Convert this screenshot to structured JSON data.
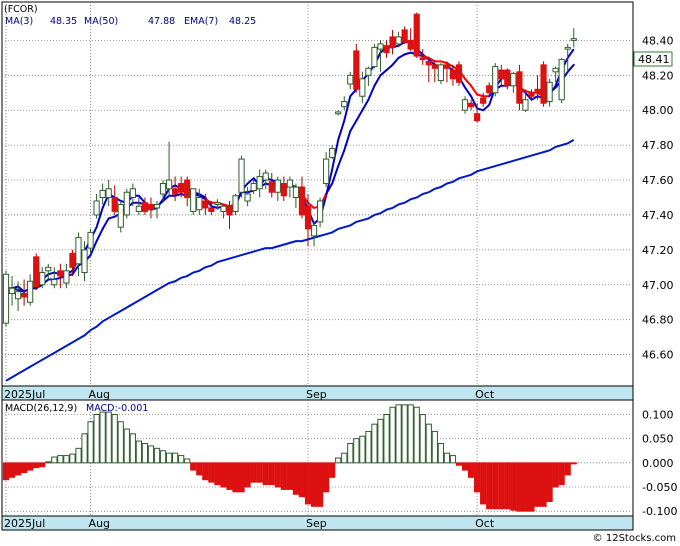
{
  "legend": {
    "ticker": "(FCOR)",
    "ma3": "MA(3)",
    "ma3_val": "48.35",
    "ma50": "MA(50)",
    "ma50_val": "47.88",
    "ema7": "EMA(7)",
    "ema7_val": "48.25"
  },
  "macd_legend": {
    "label": "MACD(26,12,9)",
    "value": "MACD:-0.001"
  },
  "last_price_label": "48.41",
  "watermark": "© 12Stocks.com",
  "colors": {
    "up": "#2e7d32",
    "down": "#dd1111",
    "ma_short": "#0000cc",
    "ma50": "#0018cc",
    "ema": "#ff0000",
    "axis_band": "#bfe6f0",
    "macd_up": "#2e7d32",
    "macd_down": "#dd1111"
  },
  "chart_data": [
    {
      "type": "candlestick",
      "title": "(FCOR)",
      "ylim": [
        46.42,
        48.62
      ],
      "y_ticks": [
        "46.60",
        "46.80",
        "47.00",
        "47.20",
        "47.40",
        "47.60",
        "47.80",
        "48.00",
        "48.20",
        "48.40"
      ],
      "x_ticks": [
        {
          "label": "2025Jul",
          "index": 0
        },
        {
          "label": "Aug",
          "index": 14
        },
        {
          "label": "Sep",
          "index": 50
        },
        {
          "label": "Oct",
          "index": 78
        }
      ],
      "candles": [
        [
          46.78,
          47.08,
          46.76,
          47.06
        ],
        [
          46.95,
          47.05,
          46.88,
          46.98
        ],
        [
          46.92,
          47.02,
          46.85,
          46.96
        ],
        [
          46.95,
          47.03,
          46.88,
          46.93
        ],
        [
          46.9,
          47.06,
          46.88,
          47.02
        ],
        [
          47.16,
          47.18,
          46.97,
          46.99
        ],
        [
          47.0,
          47.1,
          46.98,
          47.07
        ],
        [
          47.08,
          47.12,
          47.03,
          47.1
        ],
        [
          47.0,
          47.1,
          46.98,
          47.03
        ],
        [
          47.08,
          47.12,
          46.98,
          47.05
        ],
        [
          47.01,
          47.12,
          46.98,
          47.08
        ],
        [
          47.18,
          47.2,
          47.05,
          47.1
        ],
        [
          47.12,
          47.3,
          47.05,
          47.27
        ],
        [
          47.07,
          47.25,
          47.02,
          47.2
        ],
        [
          47.21,
          47.32,
          47.18,
          47.3
        ],
        [
          47.4,
          47.52,
          47.38,
          47.48
        ],
        [
          47.5,
          47.58,
          47.46,
          47.54
        ],
        [
          47.5,
          47.6,
          47.45,
          47.55
        ],
        [
          47.5,
          47.57,
          47.4,
          47.42
        ],
        [
          47.33,
          47.48,
          47.3,
          47.46
        ],
        [
          47.4,
          47.55,
          47.38,
          47.53
        ],
        [
          47.5,
          47.58,
          47.45,
          47.55
        ],
        [
          47.42,
          47.5,
          47.4,
          47.45
        ],
        [
          47.47,
          47.5,
          47.4,
          47.42
        ],
        [
          47.46,
          47.5,
          47.38,
          47.43
        ],
        [
          47.44,
          47.48,
          47.38,
          47.46
        ],
        [
          47.52,
          47.6,
          47.48,
          47.58
        ],
        [
          47.55,
          47.82,
          47.5,
          47.6
        ],
        [
          47.55,
          47.62,
          47.48,
          47.52
        ],
        [
          47.58,
          47.62,
          47.5,
          47.53
        ],
        [
          47.6,
          47.62,
          47.45,
          47.5
        ],
        [
          47.42,
          47.55,
          47.4,
          47.55
        ],
        [
          47.43,
          47.55,
          47.4,
          47.5
        ],
        [
          47.48,
          47.52,
          47.4,
          47.44
        ],
        [
          47.44,
          47.48,
          47.4,
          47.42
        ],
        [
          47.46,
          47.49,
          47.43,
          47.47
        ],
        [
          47.42,
          47.46,
          47.38,
          47.45
        ],
        [
          47.45,
          47.48,
          47.32,
          47.4
        ],
        [
          47.42,
          47.52,
          47.4,
          47.51
        ],
        [
          47.53,
          47.74,
          47.5,
          47.72
        ],
        [
          47.48,
          47.56,
          47.45,
          47.52
        ],
        [
          47.54,
          47.6,
          47.52,
          47.58
        ],
        [
          47.55,
          47.66,
          47.5,
          47.62
        ],
        [
          47.6,
          47.66,
          47.55,
          47.64
        ],
        [
          47.59,
          47.64,
          47.5,
          47.53
        ],
        [
          47.53,
          47.62,
          47.48,
          47.6
        ],
        [
          47.58,
          47.62,
          47.48,
          47.51
        ],
        [
          47.56,
          47.62,
          47.5,
          47.6
        ],
        [
          47.5,
          47.58,
          47.44,
          47.56
        ],
        [
          47.56,
          47.62,
          47.38,
          47.4
        ],
        [
          47.45,
          47.52,
          47.22,
          47.32
        ],
        [
          47.28,
          47.36,
          47.22,
          47.34
        ],
        [
          47.36,
          47.5,
          47.33,
          47.48
        ],
        [
          47.58,
          47.76,
          47.56,
          47.72
        ],
        [
          47.73,
          47.8,
          47.72,
          47.78
        ],
        [
          47.98,
          48.0,
          47.97,
          47.99
        ],
        [
          48.02,
          48.08,
          48.0,
          48.05
        ],
        [
          48.15,
          48.22,
          48.12,
          48.2
        ],
        [
          48.34,
          48.38,
          48.1,
          48.12
        ],
        [
          48.08,
          48.22,
          48.04,
          48.18
        ],
        [
          48.2,
          48.25,
          48.14,
          48.24
        ],
        [
          48.25,
          48.38,
          48.24,
          48.36
        ],
        [
          48.35,
          48.4,
          48.22,
          48.38
        ],
        [
          48.37,
          48.4,
          48.3,
          48.33
        ],
        [
          48.42,
          48.46,
          48.32,
          48.36
        ],
        [
          48.38,
          48.45,
          48.36,
          48.42
        ],
        [
          48.46,
          48.48,
          48.38,
          48.39
        ],
        [
          48.4,
          48.47,
          48.34,
          48.35
        ],
        [
          48.55,
          48.56,
          48.3,
          48.31
        ],
        [
          48.3,
          48.35,
          48.26,
          48.29
        ],
        [
          48.28,
          48.28,
          48.16,
          48.26
        ],
        [
          48.26,
          48.28,
          48.16,
          48.24
        ],
        [
          48.17,
          48.27,
          48.15,
          48.26
        ],
        [
          48.26,
          48.28,
          48.16,
          48.24
        ],
        [
          48.23,
          48.26,
          48.14,
          48.18
        ],
        [
          48.26,
          48.28,
          48.14,
          48.16
        ],
        [
          48.0,
          48.08,
          47.98,
          48.06
        ],
        [
          48.04,
          48.06,
          48.0,
          48.02
        ],
        [
          47.98,
          48.04,
          47.93,
          47.94
        ],
        [
          48.07,
          48.1,
          48.02,
          48.04
        ],
        [
          48.14,
          48.16,
          48.08,
          48.1
        ],
        [
          48.1,
          48.27,
          48.08,
          48.25
        ],
        [
          48.23,
          48.26,
          48.14,
          48.18
        ],
        [
          48.23,
          48.24,
          48.12,
          48.14
        ],
        [
          48.14,
          48.22,
          48.1,
          48.21
        ],
        [
          48.22,
          48.26,
          48.0,
          48.04
        ],
        [
          48.0,
          48.12,
          47.99,
          48.06
        ],
        [
          48.1,
          48.12,
          48.06,
          48.08
        ],
        [
          48.12,
          48.2,
          48.06,
          48.1
        ],
        [
          48.26,
          48.28,
          48.02,
          48.04
        ],
        [
          48.05,
          48.18,
          48.02,
          48.16
        ],
        [
          48.22,
          48.25,
          48.16,
          48.24
        ],
        [
          48.06,
          48.3,
          48.04,
          48.29
        ],
        [
          48.35,
          48.38,
          48.22,
          48.36
        ],
        [
          48.4,
          48.47,
          48.36,
          48.41
        ]
      ],
      "ma3": [
        46.95,
        46.98,
        46.99,
        46.96,
        46.98,
        46.98,
        47.03,
        47.06,
        47.07,
        47.06,
        47.06,
        47.08,
        47.15,
        47.19,
        47.26,
        47.33,
        47.44,
        47.52,
        47.5,
        47.48,
        47.47,
        47.51,
        47.51,
        47.47,
        47.43,
        47.44,
        47.49,
        47.55,
        47.57,
        47.55,
        47.52,
        47.53,
        47.52,
        47.5,
        47.45,
        47.44,
        47.45,
        47.44,
        47.45,
        47.54,
        47.58,
        47.61,
        47.57,
        47.61,
        47.6,
        47.59,
        47.55,
        47.57,
        47.56,
        47.52,
        47.43,
        47.35,
        47.38,
        47.51,
        47.66,
        47.83,
        47.94,
        48.08,
        48.12,
        48.17,
        48.21,
        48.26,
        48.33,
        48.36,
        48.36,
        48.37,
        48.39,
        48.39,
        48.35,
        48.32,
        48.29,
        48.26,
        48.25,
        48.25,
        48.23,
        48.19,
        48.13,
        48.08,
        48.01,
        48.0,
        48.03,
        48.13,
        48.18,
        48.19,
        48.18,
        48.13,
        48.1,
        48.06,
        48.08,
        48.07,
        48.09,
        48.14,
        48.23,
        48.3,
        48.35
      ],
      "ema7": [
        46.98,
        46.98,
        46.97,
        46.96,
        46.98,
        46.98,
        47.0,
        47.03,
        47.03,
        47.04,
        47.05,
        47.06,
        47.11,
        47.13,
        47.17,
        47.25,
        47.32,
        47.38,
        47.39,
        47.41,
        47.44,
        47.47,
        47.47,
        47.46,
        47.45,
        47.45,
        47.48,
        47.51,
        47.51,
        47.52,
        47.51,
        47.52,
        47.51,
        47.49,
        47.47,
        47.47,
        47.46,
        47.45,
        47.46,
        47.53,
        47.53,
        47.54,
        47.56,
        47.58,
        47.57,
        47.58,
        47.56,
        47.57,
        47.56,
        47.52,
        47.47,
        47.44,
        47.45,
        47.52,
        47.58,
        47.68,
        47.77,
        47.88,
        47.94,
        48.0,
        48.06,
        48.14,
        48.2,
        48.23,
        48.26,
        48.3,
        48.32,
        48.33,
        48.32,
        48.31,
        48.3,
        48.28,
        48.28,
        48.27,
        48.25,
        48.23,
        48.18,
        48.14,
        48.09,
        48.08,
        48.08,
        48.12,
        48.14,
        48.14,
        48.16,
        48.13,
        48.11,
        48.1,
        48.1,
        48.08,
        48.1,
        48.13,
        48.17,
        48.22,
        48.26
      ],
      "ma50": [
        46.45,
        46.47,
        46.49,
        46.51,
        46.53,
        46.55,
        46.57,
        46.59,
        46.61,
        46.63,
        46.65,
        46.67,
        46.69,
        46.71,
        46.74,
        46.76,
        46.79,
        46.81,
        46.83,
        46.85,
        46.87,
        46.89,
        46.91,
        46.93,
        46.95,
        46.97,
        46.99,
        47.01,
        47.02,
        47.04,
        47.05,
        47.07,
        47.08,
        47.1,
        47.11,
        47.13,
        47.14,
        47.15,
        47.16,
        47.17,
        47.18,
        47.19,
        47.2,
        47.21,
        47.21,
        47.22,
        47.23,
        47.24,
        47.25,
        47.25,
        47.26,
        47.27,
        47.28,
        47.29,
        47.3,
        47.32,
        47.33,
        47.34,
        47.36,
        47.37,
        47.38,
        47.4,
        47.41,
        47.43,
        47.44,
        47.46,
        47.47,
        47.49,
        47.5,
        47.52,
        47.53,
        47.55,
        47.56,
        47.58,
        47.59,
        47.61,
        47.62,
        47.63,
        47.65,
        47.66,
        47.67,
        47.68,
        47.69,
        47.7,
        47.71,
        47.72,
        47.73,
        47.74,
        47.75,
        47.76,
        47.77,
        47.79,
        47.8,
        47.81,
        47.83
      ]
    },
    {
      "type": "bar",
      "title": "MACD(26,12,9)",
      "ylim": [
        -0.11,
        0.13
      ],
      "y_ticks": [
        "0.100",
        "0.050",
        "0.000",
        "-0.050",
        "-0.100"
      ],
      "values": [
        -0.035,
        -0.03,
        -0.025,
        -0.02,
        -0.015,
        -0.01,
        -0.008,
        0.002,
        0.012,
        0.015,
        0.015,
        0.018,
        0.03,
        0.06,
        0.085,
        0.1,
        0.105,
        0.105,
        0.1,
        0.085,
        0.07,
        0.06,
        0.045,
        0.04,
        0.035,
        0.03,
        0.025,
        0.02,
        0.02,
        0.015,
        0.008,
        -0.015,
        -0.025,
        -0.035,
        -0.04,
        -0.045,
        -0.05,
        -0.055,
        -0.06,
        -0.06,
        -0.05,
        -0.04,
        -0.04,
        -0.045,
        -0.045,
        -0.05,
        -0.055,
        -0.055,
        -0.065,
        -0.07,
        -0.085,
        -0.09,
        -0.09,
        -0.06,
        -0.03,
        0.01,
        0.02,
        0.04,
        0.05,
        0.055,
        0.065,
        0.08,
        0.09,
        0.1,
        0.115,
        0.12,
        0.12,
        0.12,
        0.115,
        0.1,
        0.08,
        0.065,
        0.04,
        0.02,
        0.015,
        -0.005,
        -0.015,
        -0.03,
        -0.06,
        -0.085,
        -0.095,
        -0.095,
        -0.095,
        -0.095,
        -0.098,
        -0.1,
        -0.1,
        -0.1,
        -0.09,
        -0.09,
        -0.08,
        -0.05,
        -0.045,
        -0.025,
        -0.001
      ]
    }
  ]
}
